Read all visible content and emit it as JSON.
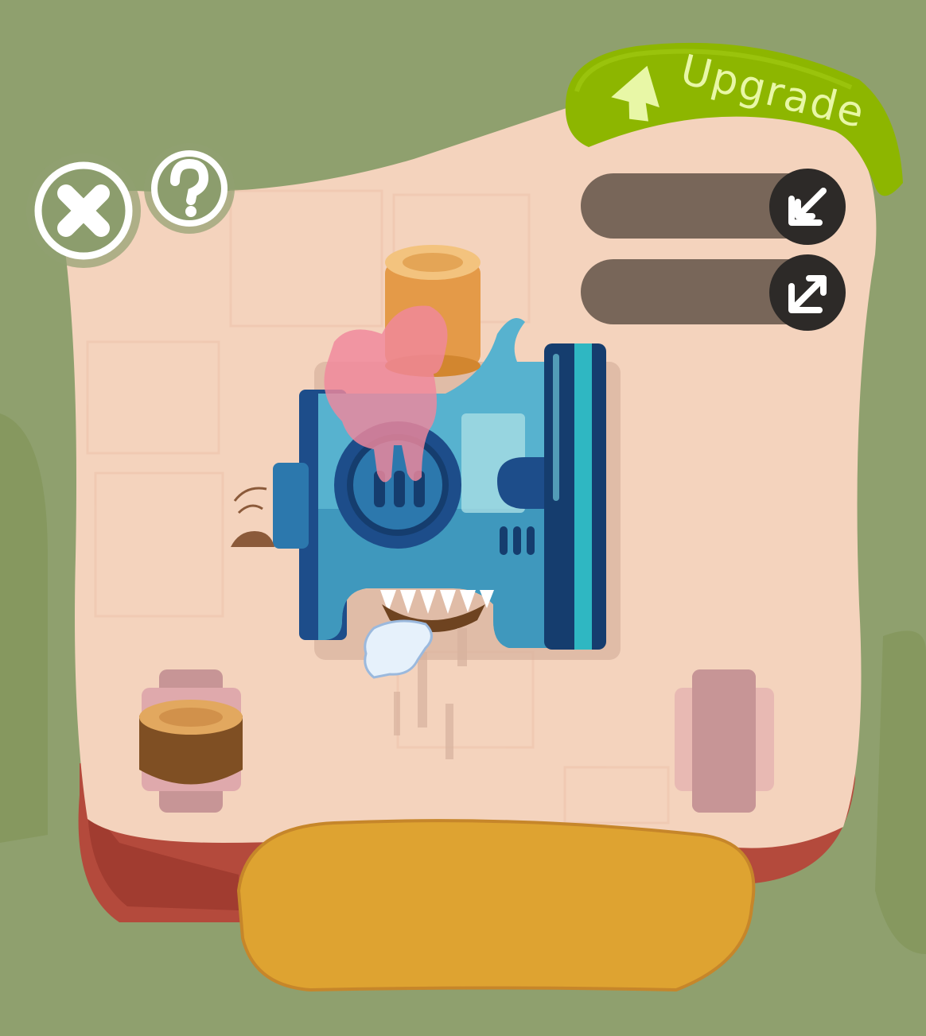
{
  "upgrade": {
    "label": "Upgrade",
    "icon": "arrow-up-icon"
  },
  "buttons": {
    "close": {
      "icon": "close-icon"
    },
    "help": {
      "icon": "question-icon"
    },
    "slot_input": {
      "icon": "arrow-in-icon"
    },
    "slot_output": {
      "icon": "arrow-out-icon"
    }
  },
  "colors": {
    "background": "#8fa06e",
    "board": "#f4d3bd",
    "upgrade_green": "#8db600",
    "machine_blue": "#4aa3c4",
    "action_bar": "#dea331"
  }
}
